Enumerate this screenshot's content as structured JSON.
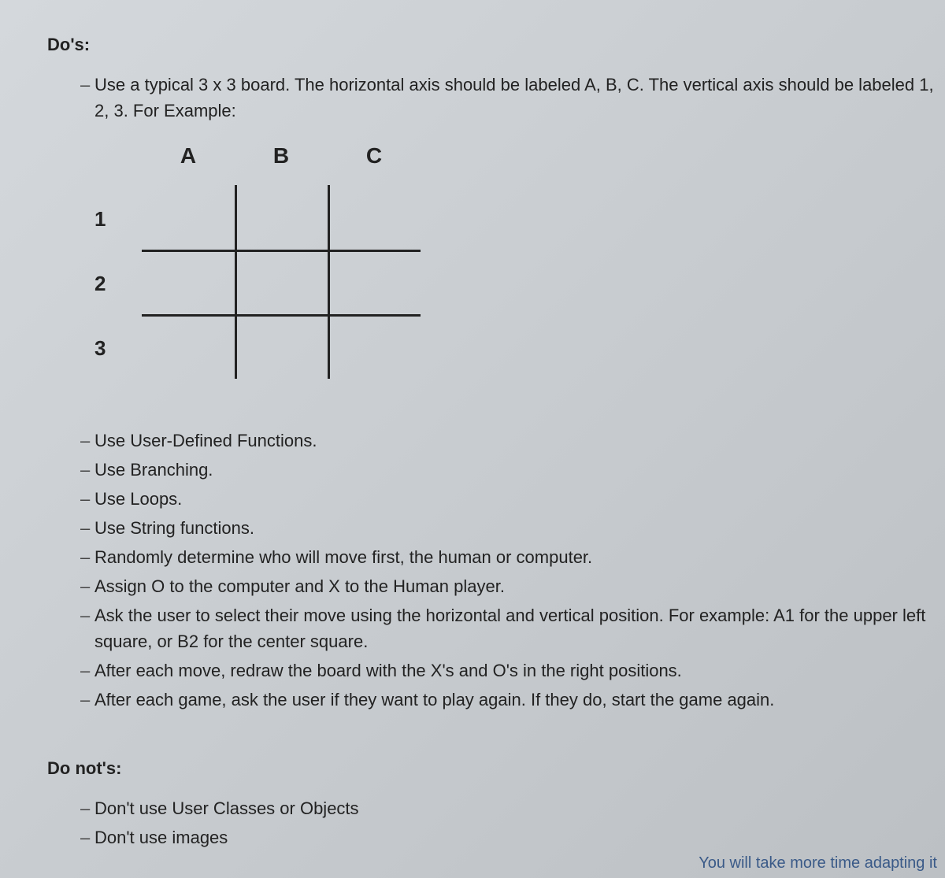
{
  "dos_heading": "Do's:",
  "do_items": [
    "Use a typical 3 x 3 board. The horizontal axis should be labeled A, B, C. The vertical axis should be labeled 1, 2, 3. For Example:",
    "Use User-Defined Functions.",
    "Use Branching.",
    "Use Loops.",
    "Use String functions.",
    "Randomly determine who will move first, the human or computer.",
    "Assign O to the computer and X to the Human player.",
    "Ask the user to select their move using the horizontal and vertical position. For example: A1 for the upper left square, or B2 for the center square.",
    "After each move, redraw the board with the X's and O's in the right positions.",
    "After each game, ask the user if they want to play again. If they do, start the game again."
  ],
  "donots_heading": "Do not's:",
  "donot_items": [
    "Don't use User Classes or Objects",
    "Don't use images"
  ],
  "board": {
    "columns": [
      "A",
      "B",
      "C"
    ],
    "rows": [
      "1",
      "2",
      "3"
    ]
  },
  "dash": "–",
  "cutoff_text": "You will take more time adapting it"
}
